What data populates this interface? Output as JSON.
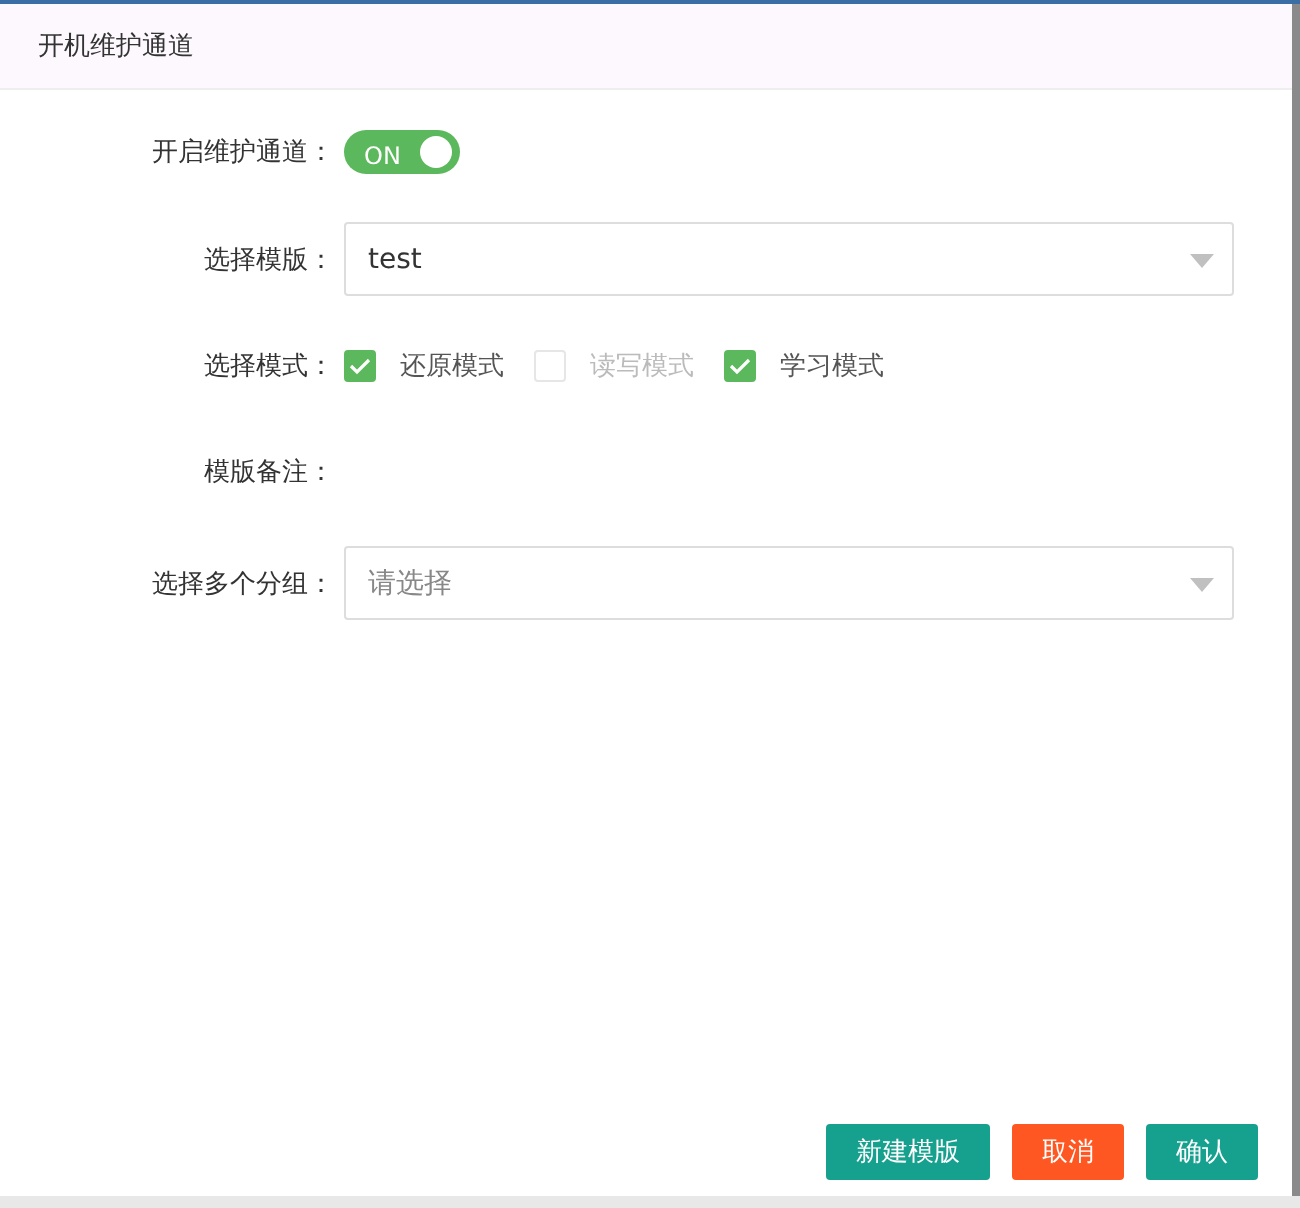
{
  "dialog": {
    "title": "开机维护通道"
  },
  "form": [
    {
      "kind": "switch",
      "label": "开启维护通道：",
      "on": true,
      "text": "ON"
    },
    {
      "kind": "select",
      "label": "选择模版：",
      "value": "test"
    },
    {
      "kind": "checkboxes",
      "label": "选择模式：",
      "options": [
        {
          "label": "还原模式",
          "checked": true,
          "disabled": false
        },
        {
          "label": "读写模式",
          "checked": false,
          "disabled": true
        },
        {
          "label": "学习模式",
          "checked": true,
          "disabled": false
        }
      ]
    },
    {
      "kind": "text",
      "label": "模版备注："
    },
    {
      "kind": "select",
      "label": "选择多个分组：",
      "placeholder": "请选择"
    }
  ],
  "buttons": [
    {
      "label": "新建模版",
      "kind": "primary"
    },
    {
      "label": "取消",
      "kind": "danger"
    },
    {
      "label": "确认",
      "kind": "primary"
    }
  ]
}
